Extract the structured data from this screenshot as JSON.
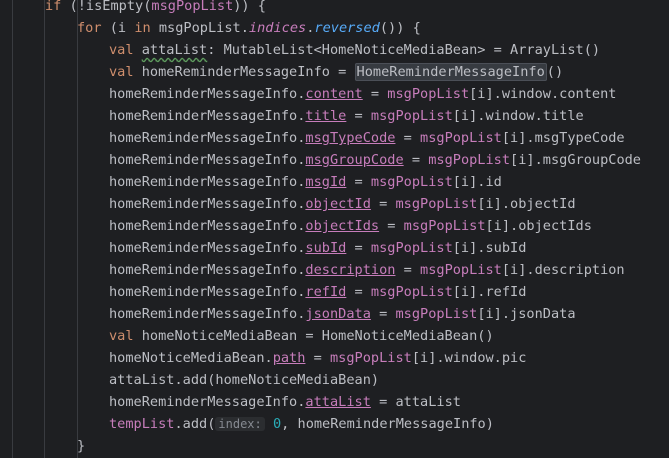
{
  "code": {
    "l0_if": "if",
    "l0_a": " (!isEmpty(",
    "l0_b": "msgPopList",
    "l0_c": ")) {",
    "l1_for": "for",
    "l1_a": " (i ",
    "l1_in": "in",
    "l1_b": " msgPopList.",
    "l1_c": "indices",
    "l1_d": ".",
    "l1_e": "reversed",
    "l1_f": "()) {",
    "l2_val": "val",
    "l2_a": " ",
    "l2_b": "attaList",
    "l2_c": ": MutableList<HomeNoticeMediaBean> = ArrayList()",
    "l3_val": "val",
    "l3_a": " homeReminderMessageInfo = ",
    "l3_b": "HomeReminderMessageInfo",
    "l3_c": "()",
    "l4_a": "homeReminderMessageInfo.",
    "l4_b": "content",
    "l4_c": " = ",
    "l4_d": "msgPopList",
    "l4_e": "[i].window.content",
    "l5_a": "homeReminderMessageInfo.",
    "l5_b": "title",
    "l5_c": " = ",
    "l5_d": "msgPopList",
    "l5_e": "[i].window.title",
    "l6_a": "homeReminderMessageInfo.",
    "l6_b": "msgTypeCode",
    "l6_c": " = ",
    "l6_d": "msgPopList",
    "l6_e": "[i].msgTypeCode",
    "l7_a": "homeReminderMessageInfo.",
    "l7_b": "msgGroupCode",
    "l7_c": " = ",
    "l7_d": "msgPopList",
    "l7_e": "[i].msgGroupCode",
    "l8_a": "homeReminderMessageInfo.",
    "l8_b": "msgId",
    "l8_c": " = ",
    "l8_d": "msgPopList",
    "l8_e": "[i].id",
    "l9_a": "homeReminderMessageInfo.",
    "l9_b": "objectId",
    "l9_c": " = ",
    "l9_d": "msgPopList",
    "l9_e": "[i].objectId",
    "l10_a": "homeReminderMessageInfo.",
    "l10_b": "objectIds",
    "l10_c": " = ",
    "l10_d": "msgPopList",
    "l10_e": "[i].objectIds",
    "l11_a": "homeReminderMessageInfo.",
    "l11_b": "subId",
    "l11_c": " = ",
    "l11_d": "msgPopList",
    "l11_e": "[i].subId",
    "l12_a": "homeReminderMessageInfo.",
    "l12_b": "description",
    "l12_c": " = ",
    "l12_d": "msgPopList",
    "l12_e": "[i].description",
    "l13_a": "homeReminderMessageInfo.",
    "l13_b": "refId",
    "l13_c": " = ",
    "l13_d": "msgPopList",
    "l13_e": "[i].refId",
    "l14_a": "homeReminderMessageInfo.",
    "l14_b": "jsonData",
    "l14_c": " = ",
    "l14_d": "msgPopList",
    "l14_e": "[i].jsonData",
    "l15_val": "val",
    "l15_a": " homeNoticeMediaBean = HomeNoticeMediaBean()",
    "l16_a": "homeNoticeMediaBean.",
    "l16_b": "path",
    "l16_c": " = ",
    "l16_d": "msgPopList",
    "l16_e": "[i].window.pic",
    "l17_a": "attaList.add(homeNoticeMediaBean)",
    "l18_a": "homeReminderMessageInfo.",
    "l18_b": "attaList",
    "l18_c": " = attaList",
    "l19_a": "tempList",
    "l19_b": ".add(",
    "l19_hint": "index:",
    "l19_c": " ",
    "l19_num": "0",
    "l19_d": ", homeReminderMessageInfo)",
    "l20_a": "}"
  },
  "colors": {
    "background": "#1e1f22",
    "keyword": "#cf8e6d",
    "property": "#c77dbb",
    "text": "#bcbec4",
    "number": "#2aacb8"
  }
}
